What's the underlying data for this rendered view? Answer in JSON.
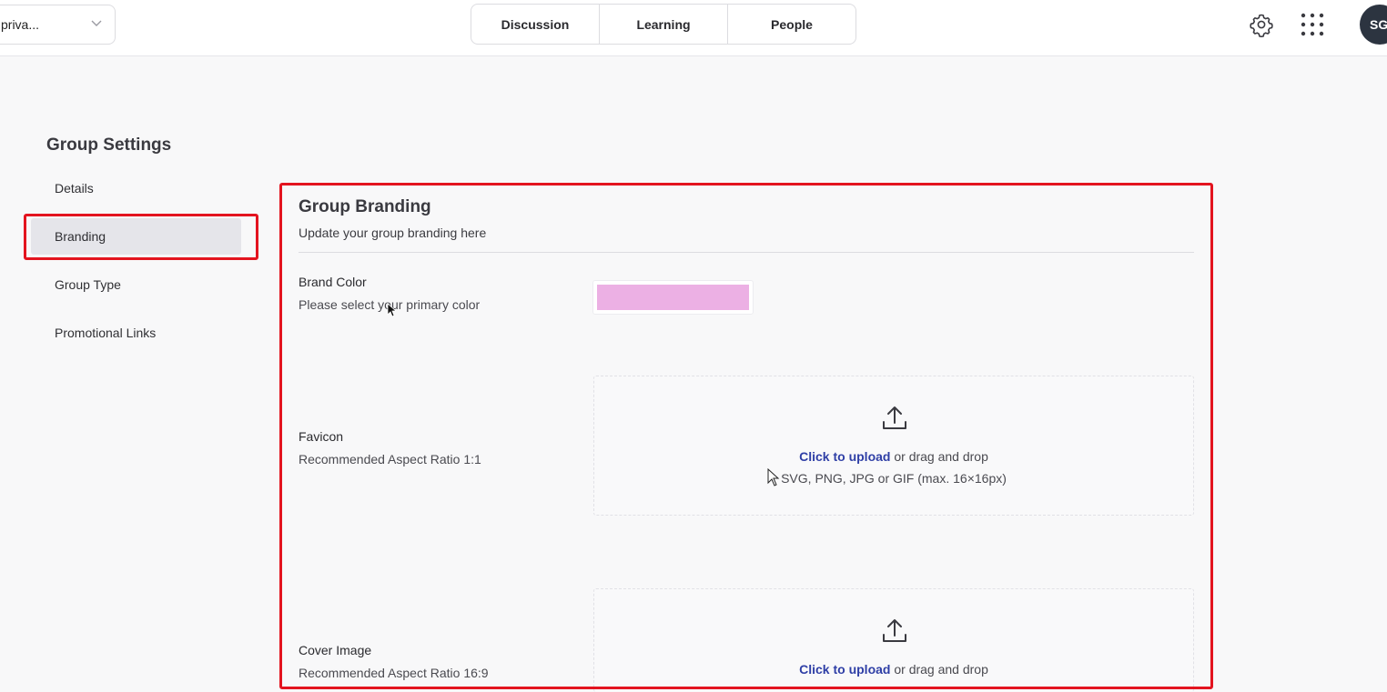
{
  "header": {
    "group_select_value": "priva...",
    "tabs": [
      {
        "label": "Discussion"
      },
      {
        "label": "Learning"
      },
      {
        "label": "People"
      }
    ],
    "avatar_initials": "SG"
  },
  "sidebar": {
    "title": "Group Settings",
    "items": [
      {
        "label": "Details"
      },
      {
        "label": "Branding",
        "active": true
      },
      {
        "label": "Group Type"
      },
      {
        "label": "Promotional Links"
      }
    ]
  },
  "branding": {
    "title": "Group Branding",
    "subtitle": "Update your group branding here",
    "brand_color": {
      "label": "Brand Color",
      "help": "Please select your primary color",
      "value": "#ecb0e4"
    },
    "favicon": {
      "label": "Favicon",
      "help": "Recommended Aspect Ratio 1:1",
      "upload_link": "Click to upload",
      "upload_text": " or drag and drop",
      "formats": "SVG, PNG, JPG or GIF (max. 16×16px)"
    },
    "cover_image": {
      "label": "Cover Image",
      "help": "Recommended Aspect Ratio 16:9",
      "upload_link": "Click to upload",
      "upload_text": " or drag and drop"
    }
  },
  "colors": {
    "highlight": "#e3141f",
    "link": "#2f3fa6",
    "avatar_bg": "#2c3440"
  },
  "icons": {
    "settings": "gear-icon",
    "apps": "apps-grid-icon",
    "upload": "upload-icon",
    "dropdown": "chevron-down-icon"
  }
}
